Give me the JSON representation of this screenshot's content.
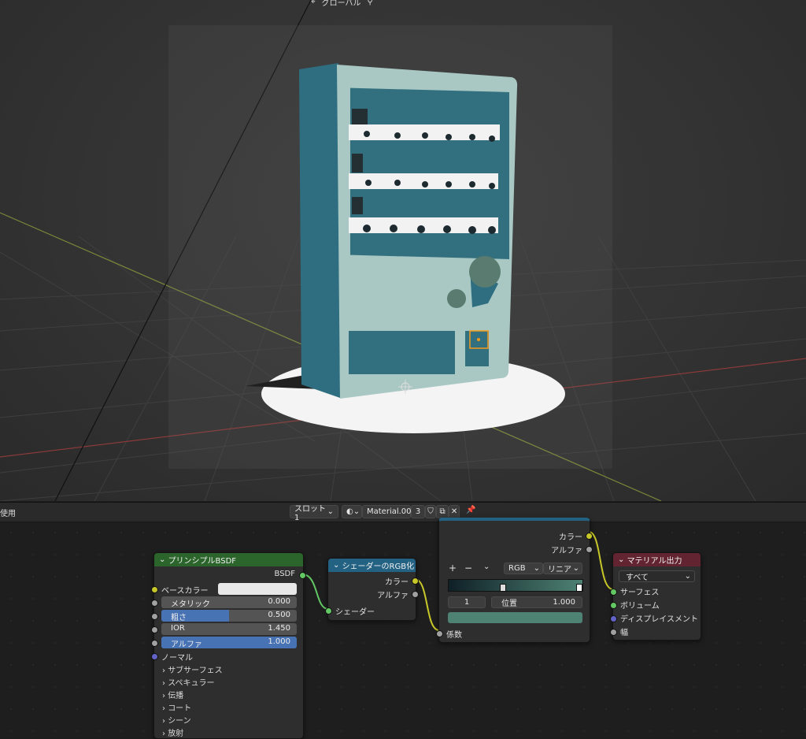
{
  "viewport": {
    "header_orientation": "グローバル",
    "colors": {
      "machine_body": "#a9c8c4",
      "machine_side": "#2e6e80",
      "panel": "#33707f",
      "window_gray": "#555555",
      "grid_line": "#3e3e3e",
      "axis_red": "#8a3a3a",
      "axis_green": "#7a8a3a",
      "selection": "#f59a1a"
    }
  },
  "editor_header": {
    "left_label": "使用",
    "slot_label": "スロット1",
    "material_name": "Material.003",
    "user_count": "3",
    "icons": [
      "sphere-icon",
      "shield-icon",
      "duplicate-icon",
      "close-icon",
      "pin-icon"
    ]
  },
  "nodes": {
    "bsdf": {
      "title": "プリンシプルBSDF",
      "output_label": "BSDF",
      "base_color_label": "ベースカラー",
      "base_color_swatch": "#e8e8e8",
      "fields": [
        {
          "label": "メタリック",
          "value": "0.000",
          "fill": 0
        },
        {
          "label": "粗さ",
          "value": "0.500",
          "fill": 0.5
        },
        {
          "label": "IOR",
          "value": "1.450",
          "fill": 0
        },
        {
          "label": "アルファ",
          "value": "1.000",
          "fill": 1
        }
      ],
      "normal_label": "ノーマル",
      "panels": [
        "サブサーフェス",
        "スペキュラー",
        "伝播",
        "コート",
        "シーン",
        "放射"
      ]
    },
    "shader_to_rgb": {
      "title": "シェーダーのRGB化",
      "out_color": "カラー",
      "out_alpha": "アルファ",
      "in_shader": "シェーダー"
    },
    "color_ramp": {
      "out_color": "カラー",
      "out_alpha": "アルファ",
      "add": "+",
      "remove": "−",
      "mode": "RGB",
      "interpolation": "リニア",
      "stop_index": "1",
      "position_label": "位置",
      "position_value": "1.000",
      "stop_color": "#4e8273",
      "ramp_start": "#0f2027",
      "ramp_end": "#4e8273",
      "in_factor": "係数"
    },
    "material_output": {
      "title": "マテリアル出力",
      "target": "すべて",
      "inputs": [
        "サーフェス",
        "ボリューム",
        "ディスプレイスメント",
        "幅"
      ]
    }
  }
}
